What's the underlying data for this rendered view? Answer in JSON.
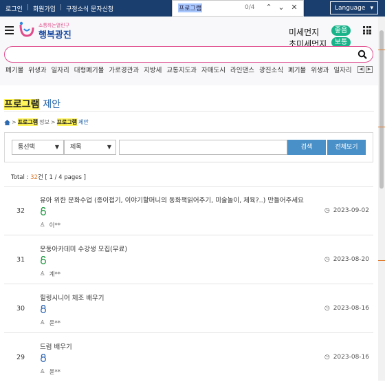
{
  "topbar": {
    "links": [
      "로그인",
      "회원가입",
      "구정소식 문자신청"
    ],
    "language": "Language"
  },
  "findbar": {
    "query": "프로그램",
    "count": "0/4"
  },
  "header": {
    "logo_small": "소통하는열린구",
    "logo_big": "행복광진",
    "dust": [
      {
        "label": "미세먼지",
        "status": "좋음"
      },
      {
        "label": "초미세먼지",
        "status": "보통"
      }
    ],
    "search_placeholder": ""
  },
  "keywords": [
    "폐기물",
    "위생과",
    "일자리",
    "대형폐기물",
    "가로경관과",
    "지방세",
    "교통지도과",
    "자매도시",
    "라인댄스",
    "광진소식",
    "폐기물",
    "위생과",
    "일자리"
  ],
  "page": {
    "title_highlight": "프로그램",
    "title_rest": "제안",
    "breadcrumb": [
      {
        "hl": "프로그램",
        "rest": "정보"
      },
      {
        "hl": "프로그램",
        "rest": "제안"
      }
    ]
  },
  "filter": {
    "select1": "통선택",
    "select2": "제목",
    "query": "",
    "search_btn": "검색",
    "all_btn": "전체보기"
  },
  "total": {
    "label": "Total : ",
    "count": "32",
    "unit": "건",
    "pages": "[ 1 / 4 pages ]"
  },
  "posts": [
    {
      "num": "32",
      "title": "유아 위한 문화수업 (종이접기, 이야기할머니의 동화책읽어주기, 미술놀이, 체육?..) 만들어주세요",
      "lock": "open",
      "author": "이**",
      "date": "2023-09-02"
    },
    {
      "num": "31",
      "title": "운동아카데미 수강생 모집(무료)",
      "lock": "open",
      "author": "계**",
      "date": "2023-08-20"
    },
    {
      "num": "30",
      "title": "힐링시니어 체조 배우기",
      "lock": "closed",
      "author": "윤**",
      "date": "2023-08-16"
    },
    {
      "num": "29",
      "title": "드럼 배우기",
      "lock": "closed",
      "author": "윤**",
      "date": "2023-08-16"
    }
  ],
  "colors": {
    "topbar": "#1a3e6e",
    "accent_blue": "#1b5fa8",
    "highlight": "#fff45a",
    "count_orange": "#e07a2e",
    "lock_open": "#2a9d4a",
    "lock_closed": "#3b6fb6"
  }
}
